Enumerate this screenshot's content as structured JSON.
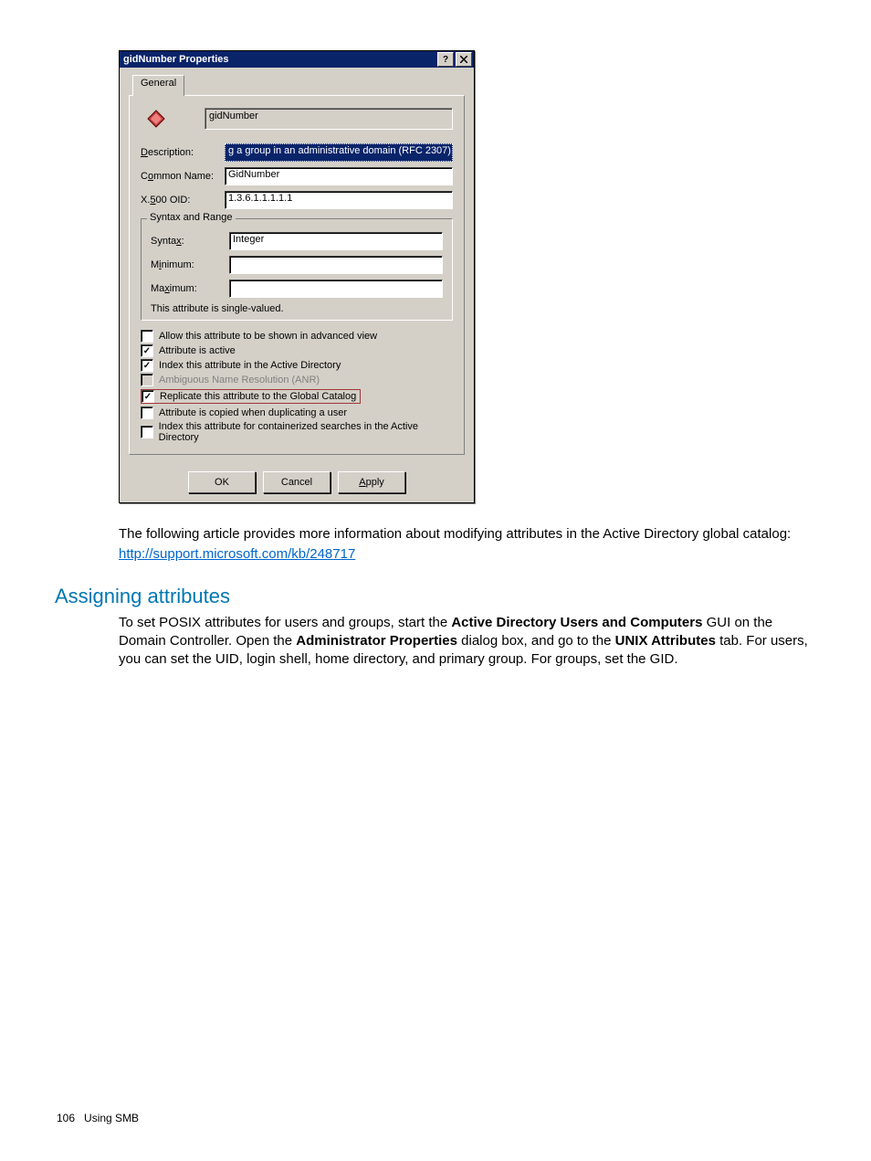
{
  "dialog": {
    "title": "gidNumber Properties",
    "tab": "General",
    "attribute_name": "gidNumber",
    "labels": {
      "description": "Description:",
      "common_name": "Common Name:",
      "x500_oid": "X.500 OID:",
      "syntax": "Syntax:",
      "minimum": "Minimum:",
      "maximum": "Maximum:"
    },
    "values": {
      "description": "g a group in an administrative domain (RFC 2307)",
      "common_name": "GidNumber",
      "x500_oid": "1.3.6.1.1.1.1.1",
      "syntax": "Integer",
      "minimum": "",
      "maximum": ""
    },
    "group_title": "Syntax and Range",
    "single_valued_note": "This attribute is single-valued.",
    "checks": [
      {
        "label": "Allow this attribute to be shown in advanced view",
        "checked": false,
        "disabled": false
      },
      {
        "label": "Attribute is active",
        "checked": true,
        "disabled": false
      },
      {
        "label": "Index this attribute in the Active Directory",
        "checked": true,
        "disabled": false
      },
      {
        "label": "Ambiguous Name Resolution (ANR)",
        "checked": false,
        "disabled": true
      },
      {
        "label": "Replicate this attribute to the Global Catalog",
        "checked": true,
        "disabled": false,
        "highlighted": true
      },
      {
        "label": "Attribute is copied when duplicating a user",
        "checked": false,
        "disabled": false
      },
      {
        "label": "Index this attribute for containerized searches in the Active Directory",
        "checked": false,
        "disabled": false
      }
    ],
    "buttons": {
      "ok": "OK",
      "cancel": "Cancel",
      "apply": "Apply"
    }
  },
  "body": {
    "para1": "The following article provides more information about modifying attributes in the Active Directory global catalog:",
    "link": "http://support.microsoft.com/kb/248717",
    "heading": "Assigning attributes",
    "para2a": "To set POSIX attributes for users and groups, start the ",
    "bold1": "Active Directory Users and Computers",
    "para2b": " GUI on the Domain Controller. Open the ",
    "bold2": "Administrator Properties",
    "para2c": " dialog box, and go to the ",
    "bold3": "UNIX Attributes",
    "para2d": " tab. For users, you can set the UID, login shell, home directory, and primary group. For groups, set the GID."
  },
  "footer": {
    "page": "106",
    "section": "Using SMB"
  }
}
